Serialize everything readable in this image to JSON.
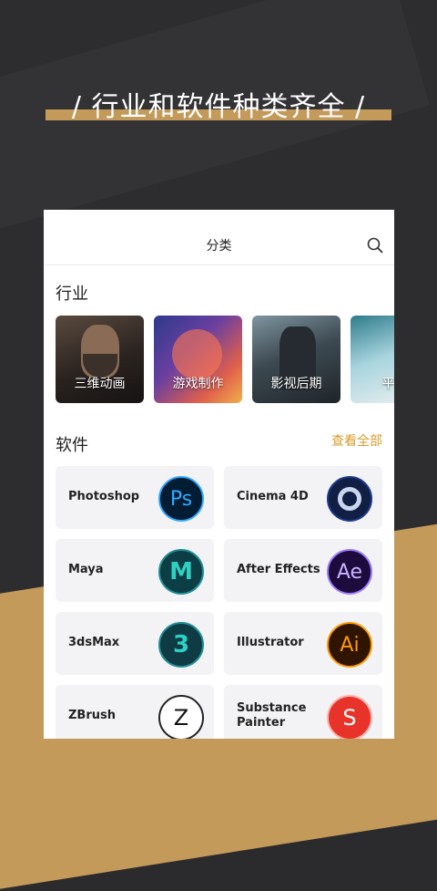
{
  "headline": "/ 行业和软件种类齐全 /",
  "colors": {
    "accent_gold": "#c39a5a",
    "see_all": "#d99a2a",
    "bg_dark": "#2d2d2f"
  },
  "nav": {
    "title": "分类",
    "search_icon": "search-icon"
  },
  "industry": {
    "title": "行业",
    "items": [
      {
        "label": "三维动画"
      },
      {
        "label": "游戏制作"
      },
      {
        "label": "影视后期"
      },
      {
        "label": "平面"
      }
    ]
  },
  "software": {
    "title": "软件",
    "see_all": "查看全部",
    "items": [
      {
        "name": "Photoshop",
        "icon_text": "Ps",
        "icon": "photoshop-icon"
      },
      {
        "name": "Cinema 4D",
        "icon_text": "",
        "icon": "cinema-4d-icon"
      },
      {
        "name": "Maya",
        "icon_text": "M",
        "icon": "maya-icon"
      },
      {
        "name": "After Effects",
        "icon_text": "Ae",
        "icon": "after-effects-icon"
      },
      {
        "name": "3dsMax",
        "icon_text": "3",
        "icon": "3dsmax-icon"
      },
      {
        "name": "Illustrator",
        "icon_text": "Ai",
        "icon": "illustrator-icon"
      },
      {
        "name": "ZBrush",
        "icon_text": "Z",
        "icon": "zbrush-icon"
      },
      {
        "name": "Substance Painter",
        "icon_text": "S",
        "icon": "substance-painter-icon"
      }
    ]
  }
}
